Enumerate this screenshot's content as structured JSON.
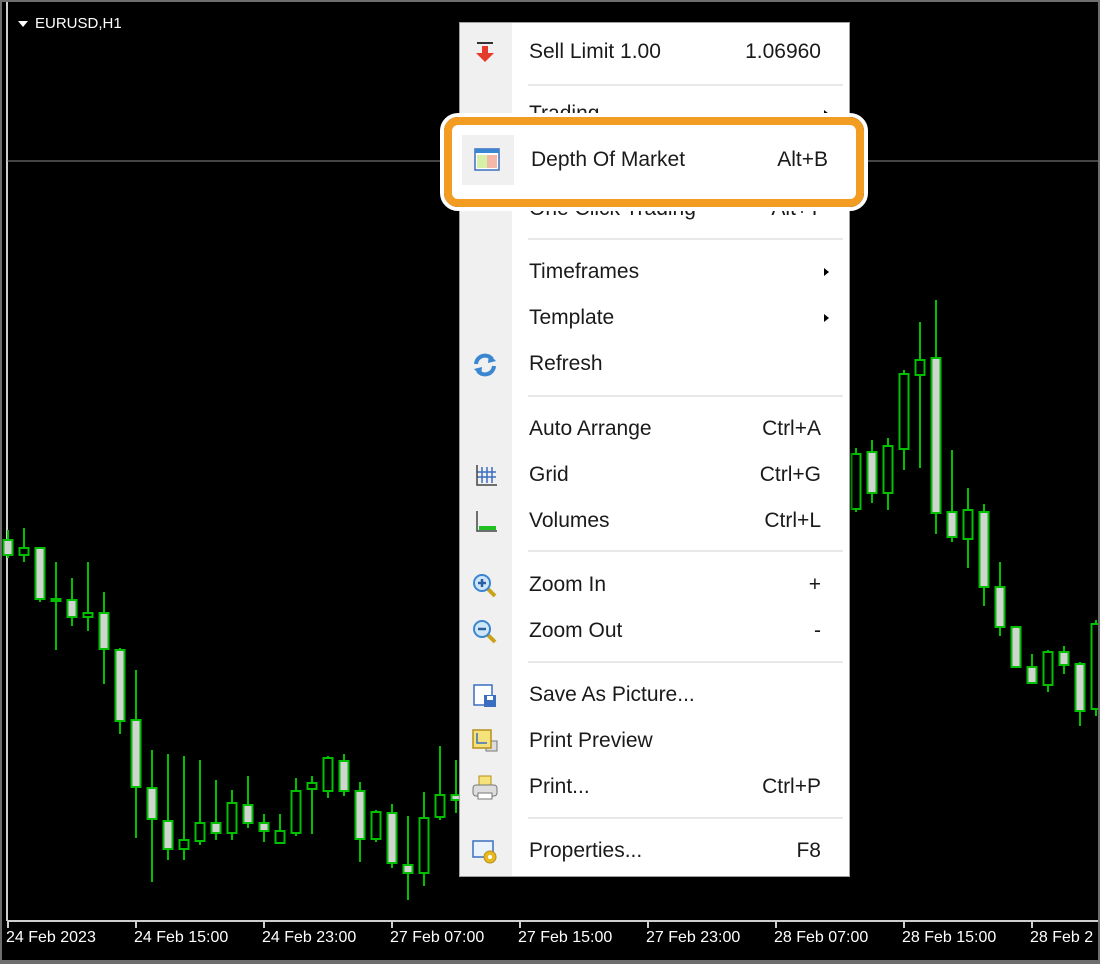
{
  "chart": {
    "symbol_title": "EURUSD,H1",
    "colors": {
      "background": "#000000",
      "candle_outline": "#00c000",
      "bear_fill": "#d3d3d3",
      "bull_fill": "#000000",
      "order_line": "#8a8a8a",
      "highlight": "#f39c22"
    },
    "x_labels": [
      "24 Feb 2023",
      "24 Feb 15:00",
      "24 Feb 23:00",
      "27 Feb 07:00",
      "27 Feb 15:00",
      "27 Feb 23:00",
      "28 Feb 07:00",
      "28 Feb 15:00",
      "28 Feb 2"
    ]
  },
  "chart_data": {
    "type": "candlestick",
    "timeframe": "H1",
    "order_line_price": 1.0696,
    "candles_columns": [
      "time",
      "open",
      "high",
      "low",
      "close"
    ],
    "candles": [
      [
        "2023-02-24 07:00",
        1.06202,
        1.06222,
        1.06166,
        1.06172
      ],
      [
        "2023-02-24 08:00",
        1.06172,
        1.06226,
        1.06158,
        1.06186
      ],
      [
        "2023-02-24 09:00",
        1.06186,
        1.06186,
        1.06078,
        1.06084
      ],
      [
        "2023-02-24 10:00",
        1.06084,
        1.06158,
        1.05982,
        1.0608
      ],
      [
        "2023-02-24 11:00",
        1.06082,
        1.06126,
        1.0603,
        1.06048
      ],
      [
        "2023-02-24 12:00",
        1.06048,
        1.06158,
        1.0602,
        1.06056
      ],
      [
        "2023-02-24 13:00",
        1.06056,
        1.06098,
        1.05914,
        1.05984
      ],
      [
        "2023-02-24 14:00",
        1.05982,
        1.05986,
        1.05814,
        1.0584
      ],
      [
        "2023-02-24 15:00",
        1.05842,
        1.05942,
        1.05606,
        1.05708
      ],
      [
        "2023-02-24 16:00",
        1.05706,
        1.05782,
        1.05518,
        1.05644
      ],
      [
        "2023-02-24 17:00",
        1.0564,
        1.05774,
        1.05562,
        1.05584
      ],
      [
        "2023-02-24 18:00",
        1.05584,
        1.0577,
        1.05562,
        1.05602
      ],
      [
        "2023-02-24 19:00",
        1.056,
        1.05762,
        1.05592,
        1.05636
      ],
      [
        "2023-02-24 20:00",
        1.05636,
        1.05722,
        1.05602,
        1.05616
      ],
      [
        "2023-02-24 21:00",
        1.05616,
        1.05702,
        1.05602,
        1.05676
      ],
      [
        "2023-02-24 22:00",
        1.05672,
        1.0573,
        1.05626,
        1.05636
      ],
      [
        "2023-02-24 23:00",
        1.05636,
        1.05654,
        1.05598,
        1.0562
      ],
      [
        "2023-02-27 00:00",
        1.05596,
        1.05654,
        1.05596,
        1.0562
      ],
      [
        "2023-02-27 01:00",
        1.05616,
        1.05726,
        1.0561,
        1.057
      ],
      [
        "2023-02-27 02:00",
        1.05704,
        1.0573,
        1.05614,
        1.05716
      ],
      [
        "2023-02-27 03:00",
        1.057,
        1.0577,
        1.05686,
        1.05766
      ],
      [
        "2023-02-27 04:00",
        1.0576,
        1.05774,
        1.0569,
        1.057
      ],
      [
        "2023-02-27 05:00",
        1.057,
        1.05718,
        1.05558,
        1.05604
      ],
      [
        "2023-02-27 06:00",
        1.05604,
        1.05662,
        1.05598,
        1.05658
      ],
      [
        "2023-02-27 07:00",
        1.05656,
        1.05674,
        1.05546,
        1.05556
      ],
      [
        "2023-02-27 08:00",
        1.05552,
        1.0565,
        1.05482,
        1.05536
      ],
      [
        "2023-02-27 09:00",
        1.05536,
        1.05698,
        1.0551,
        1.05646
      ],
      [
        "2023-02-27 10:00",
        1.05648,
        1.0579,
        1.05642,
        1.05692
      ],
      [
        "2023-02-27 11:00",
        1.05692,
        1.05762,
        1.05656,
        1.05682
      ],
      [
        "2023-02-28 12:00",
        1.06264,
        1.06386,
        1.06258,
        1.06374
      ],
      [
        "2023-02-28 13:00",
        1.06378,
        1.06402,
        1.06276,
        1.06296
      ],
      [
        "2023-02-28 14:00",
        1.06296,
        1.06406,
        1.06262,
        1.0639
      ],
      [
        "2023-02-28 15:00",
        1.06384,
        1.06542,
        1.06342,
        1.06534
      ],
      [
        "2023-02-28 16:00",
        1.06532,
        1.06638,
        1.06346,
        1.06562
      ],
      [
        "2023-02-28 17:00",
        1.06566,
        1.06682,
        1.06214,
        1.06256
      ],
      [
        "2023-02-28 18:00",
        1.06258,
        1.06382,
        1.06198,
        1.06208
      ],
      [
        "2023-02-28 19:00",
        1.06204,
        1.06306,
        1.06146,
        1.06262
      ],
      [
        "2023-02-28 20:00",
        1.06258,
        1.06274,
        1.0607,
        1.06108
      ],
      [
        "2023-02-28 21:00",
        1.06108,
        1.06158,
        1.0601,
        1.06028
      ],
      [
        "2023-02-28 22:00",
        1.06028,
        1.06028,
        1.05948,
        1.05948
      ],
      [
        "2023-02-28 23:00",
        1.05948,
        1.05974,
        1.05914,
        1.05916
      ],
      [
        "2023-03-01 00:00",
        1.05912,
        1.05982,
        1.05898,
        1.05978
      ],
      [
        "2023-03-01 01:00",
        1.05978,
        1.0599,
        1.05934,
        1.05952
      ],
      [
        "2023-03-01 02:00",
        1.05954,
        1.05958,
        1.0583,
        1.0586
      ],
      [
        "2023-03-01 03:00",
        1.05864,
        1.06042,
        1.0585,
        1.06034
      ]
    ]
  },
  "context_menu": {
    "items": [
      {
        "label": "Sell Limit 1.00",
        "shortcut": "1.06960",
        "icon": "sell-limit-arrow-icon"
      },
      {
        "label": "Trading",
        "submenu": true
      },
      {
        "label": "Depth Of Market",
        "shortcut": "Alt+B",
        "icon": "depth-of-market-icon",
        "highlighted": true
      },
      {
        "label": "One Click Trading",
        "shortcut": "Alt+T",
        "icon": "one-click-trading-icon"
      },
      {
        "label": "Timeframes",
        "submenu": true
      },
      {
        "label": "Template",
        "submenu": true
      },
      {
        "label": "Refresh",
        "icon": "refresh-icon"
      },
      {
        "label": "Auto Arrange",
        "shortcut": "Ctrl+A"
      },
      {
        "label": "Grid",
        "shortcut": "Ctrl+G",
        "icon": "grid-icon"
      },
      {
        "label": "Volumes",
        "shortcut": "Ctrl+L",
        "icon": "volumes-icon"
      },
      {
        "label": "Zoom In",
        "shortcut": "+",
        "icon": "zoom-in-icon"
      },
      {
        "label": "Zoom Out",
        "shortcut": "-",
        "icon": "zoom-out-icon"
      },
      {
        "label": "Save As Picture...",
        "icon": "save-picture-icon"
      },
      {
        "label": "Print Preview",
        "icon": "print-preview-icon"
      },
      {
        "label": "Print...",
        "shortcut": "Ctrl+P",
        "icon": "printer-icon"
      },
      {
        "label": "Properties...",
        "shortcut": "F8",
        "icon": "properties-icon"
      }
    ]
  }
}
